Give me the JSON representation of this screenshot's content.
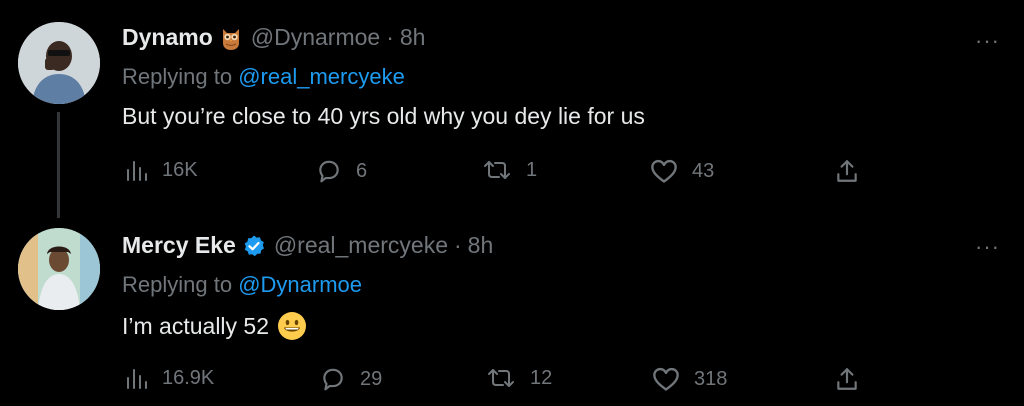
{
  "tweets": [
    {
      "name": "Dynamo",
      "name_badge": "owl-emoji",
      "handle": "@Dynarmoe",
      "separator": "·",
      "time": "8h",
      "replying_prefix": "Replying to",
      "replying_to": "@real_mercyeke",
      "text": "But you’re close to 40 yrs old why you dey lie for us",
      "more": "···",
      "stats": {
        "views": "16K",
        "replies": "6",
        "retweets": "1",
        "likes": "43"
      }
    },
    {
      "name": "Mercy Eke",
      "name_badge": "verified-badge",
      "handle": "@real_mercyeke",
      "separator": "·",
      "time": "8h",
      "replying_prefix": "Replying to",
      "replying_to": "@Dynarmoe",
      "text": "I’m actually 52",
      "text_emoji": "grinning-face-emoji",
      "more": "···",
      "stats": {
        "views": "16.9K",
        "replies": "29",
        "retweets": "12",
        "likes": "318"
      }
    }
  ],
  "colors": {
    "background": "#000000",
    "text": "#e7e9ea",
    "muted": "#71767b",
    "accent": "#1d9bf0",
    "thread_line": "#333639"
  }
}
